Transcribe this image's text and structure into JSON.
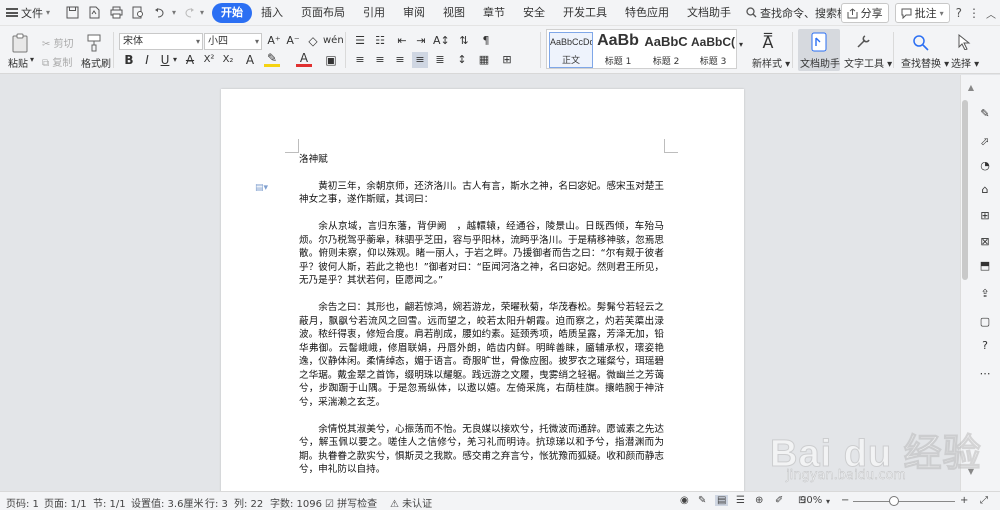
{
  "menubar": {
    "file_label": "文件",
    "tabs": [
      {
        "label": "开始",
        "active": true
      },
      {
        "label": "插入"
      },
      {
        "label": "页面布局"
      },
      {
        "label": "引用"
      },
      {
        "label": "审阅"
      },
      {
        "label": "视图"
      },
      {
        "label": "章节"
      },
      {
        "label": "安全"
      },
      {
        "label": "开发工具"
      },
      {
        "label": "特色应用"
      },
      {
        "label": "文档助手"
      }
    ],
    "search_placeholder": "查找命令、搜索模板",
    "share_label": "分享",
    "comment_label": "批注"
  },
  "ribbon": {
    "paste_label": "粘贴",
    "cut_label": "剪切",
    "copy_label": "复制",
    "format_painter_label": "格式刷",
    "font_name": "宋体",
    "font_size": "小四",
    "styles": [
      {
        "preview": "AaBbCcDd",
        "name": "正文"
      },
      {
        "preview": "AaBb",
        "name": "标题 1"
      },
      {
        "preview": "AaBbC",
        "name": "标题 2"
      },
      {
        "preview": "AaBbC(",
        "name": "标题 3"
      }
    ],
    "new_style_label": "新样式",
    "doc_assistant_label": "文档助手",
    "text_tools_label": "文字工具",
    "find_replace_label": "查找替换",
    "select_label": "选择",
    "accent_color": "#2b6ff3",
    "font_color": "#e03030",
    "highlight_color": "#f5d312"
  },
  "document": {
    "title": "洛神赋",
    "paragraphs": [
      "黄初三年，余朝京师，还济洛川。古人有言，斯水之神，名曰宓妃。感宋玉对楚王神女之事，遂作斯赋，其词曰：",
      "余从京域，言归东藩，背伊阙　，越轘辕，经通谷，陵景山。日既西倾，车殆马烦。尔乃税驾乎蘅皋，秣驷乎芝田，容与乎阳林，流眄乎洛川。于是精移神骇，忽焉思散。俯则未察，仰以殊观。睹一丽人，于岩之畔。乃援御者而告之曰：“尔有觌于彼者乎？彼何人斯，若此之艳也！”御者对曰：“臣闻河洛之神，名曰宓妃。然则君王所见，无乃是乎？其状若何，臣愿闻之。”",
      "余告之曰：其形也，翩若惊鸿，婉若游龙，荣曜秋菊，华茂春松。髣髴兮若轻云之蔽月，飘飖兮若流风之回雪。远而望之，皎若太阳升朝霞。迫而察之，灼若芙蕖出渌波。秾纤得衷，修短合度。肩若削成，腰如约素。延颈秀项，皓质呈露，芳泽无加，铅华弗御。云髻峨峨，修眉联娟，丹唇外朗，皓齿内鲜。明眸善睐，靥辅承权，瓌姿艳逸，仪静体闲。柔情绰态，媚于语言。奇服旷世，骨像应图。披罗衣之璀粲兮，珥瑶碧之华琚。戴金翠之首饰，缀明珠以耀躯。践远游之文履，曳雾绡之轻裾。微幽兰之芳蔼兮，步踟蹰于山隅。于是忽焉纵体，以遨以嬉。左倚采旄，右荫桂旗。攘皓腕于神浒兮，采湍濑之玄芝。",
      "余情悦其淑美兮，心振荡而不怡。无良媒以接欢兮，托微波而通辞。愿诚素之先达兮，解玉佩以要之。嗟佳人之信修兮，羌习礼而明诗。抗琼珶以和予兮，指潜渊而为期。执眷眷之款实兮，惧斯灵之我欺。感交甫之弃言兮，怅犹豫而狐疑。收和颜而静志兮，申礼防以自持。"
    ]
  },
  "statusbar": {
    "page_num": "页码: 1",
    "pages": "页面: 1/1",
    "section": "节: 1/1",
    "position": "设置值: 3.6厘米",
    "line": "行: 3",
    "column": "列: 22",
    "word_count": "字数: 1096",
    "spell_check": "拼写检查",
    "auth": "未认证",
    "zoom": "90%",
    "zoom_level": 0.4
  },
  "watermark": {
    "brand": "Bai du 经验",
    "site": "jingyan.baidu.com"
  }
}
